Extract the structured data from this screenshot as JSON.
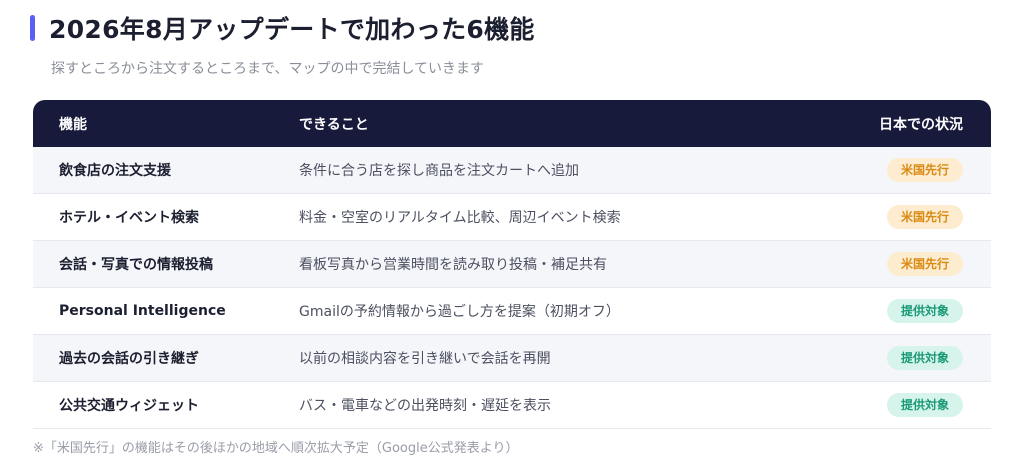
{
  "header": {
    "title": "2026年8月アップデートで加わった6機能",
    "subtitle": "探すところから注文するところまで、マップの中で完結していきます",
    "accent_color": "#5b5ef5"
  },
  "table": {
    "columns": [
      "機能",
      "できること",
      "日本での状況"
    ],
    "header_bg": "#171a3b",
    "rows": [
      {
        "feature": "飲食店の注文支援",
        "description": "条件に合う店を探し商品を注文カートへ追加",
        "status": "米国先行",
        "status_kind": "us"
      },
      {
        "feature": "ホテル・イベント検索",
        "description": "料金・空室のリアルタイム比較、周辺イベント検索",
        "status": "米国先行",
        "status_kind": "us"
      },
      {
        "feature": "会話・写真での情報投稿",
        "description": "看板写真から営業時間を読み取り投稿・補足共有",
        "status": "米国先行",
        "status_kind": "us"
      },
      {
        "feature": "Personal Intelligence",
        "description": "Gmailの予約情報から過ごし方を提案（初期オフ）",
        "status": "提供対象",
        "status_kind": "jp"
      },
      {
        "feature": "過去の会話の引き継ぎ",
        "description": "以前の相談内容を引き継いで会話を再開",
        "status": "提供対象",
        "status_kind": "jp"
      },
      {
        "feature": "公共交通ウィジェット",
        "description": "バス・電車などの出発時刻・遅延を表示",
        "status": "提供対象",
        "status_kind": "jp"
      }
    ],
    "badge_colors": {
      "us": {
        "bg": "#fdeccf",
        "fg": "#d98a12"
      },
      "jp": {
        "bg": "#d6f4ec",
        "fg": "#1b9a78"
      }
    }
  },
  "footnote": "※「米国先行」の機能はその後ほかの地域へ順次拡大予定（Google公式発表より）"
}
